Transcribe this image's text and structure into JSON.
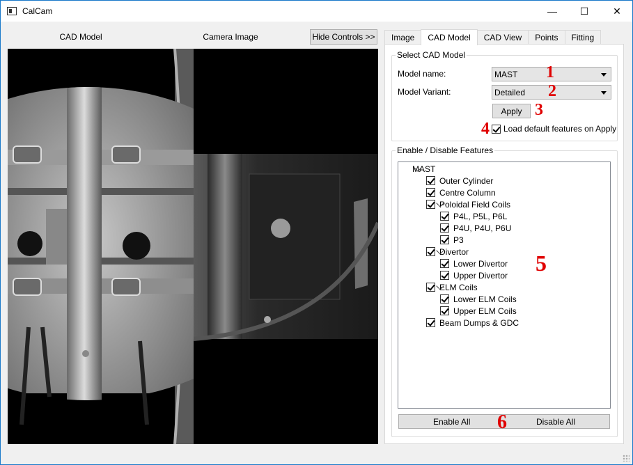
{
  "window": {
    "title": "CalCam",
    "minimize_glyph": "—",
    "maximize_glyph": "☐",
    "close_glyph": "✕"
  },
  "panes": {
    "cad_label": "CAD Model",
    "camera_label": "Camera Image",
    "hide_controls": "Hide Controls >>"
  },
  "tabs": [
    "Image",
    "CAD Model",
    "CAD View",
    "Points",
    "Fitting"
  ],
  "active_tab": "CAD Model",
  "select_model": {
    "group_title": "Select CAD Model",
    "model_name_label": "Model name:",
    "model_name_value": "MAST",
    "model_variant_label": "Model Variant:",
    "model_variant_value": "Detailed",
    "apply_label": "Apply",
    "load_default_label": "Load default features on Apply",
    "load_default_checked": true
  },
  "features": {
    "group_title": "Enable / Disable Features",
    "tree": [
      {
        "label": "MAST",
        "level": 0,
        "expandable": true,
        "checkbox": false
      },
      {
        "label": "Outer Cylinder",
        "level": 1,
        "expandable": false,
        "checkbox": true
      },
      {
        "label": "Centre Column",
        "level": 1,
        "expandable": false,
        "checkbox": true
      },
      {
        "label": "Poloidal Field Coils",
        "level": 1,
        "expandable": true,
        "checkbox": true
      },
      {
        "label": "P4L, P5L, P6L",
        "level": 2,
        "expandable": false,
        "checkbox": true
      },
      {
        "label": "P4U, P4U, P6U",
        "level": 2,
        "expandable": false,
        "checkbox": true
      },
      {
        "label": "P3",
        "level": 2,
        "expandable": false,
        "checkbox": true
      },
      {
        "label": "Divertor",
        "level": 1,
        "expandable": true,
        "checkbox": true
      },
      {
        "label": "Lower Divertor",
        "level": 2,
        "expandable": false,
        "checkbox": true
      },
      {
        "label": "Upper Divertor",
        "level": 2,
        "expandable": false,
        "checkbox": true
      },
      {
        "label": "ELM Coils",
        "level": 1,
        "expandable": true,
        "checkbox": true
      },
      {
        "label": "Lower ELM Coils",
        "level": 2,
        "expandable": false,
        "checkbox": true
      },
      {
        "label": "Upper ELM Coils",
        "level": 2,
        "expandable": false,
        "checkbox": true
      },
      {
        "label": "Beam Dumps & GDC",
        "level": 1,
        "expandable": false,
        "checkbox": true
      }
    ],
    "enable_all": "Enable All",
    "disable_all": "Disable All"
  },
  "annotations": [
    "1",
    "2",
    "3",
    "4",
    "5",
    "6"
  ],
  "colors": {
    "annotation": "#e00000",
    "title_border": "#1979ca"
  }
}
